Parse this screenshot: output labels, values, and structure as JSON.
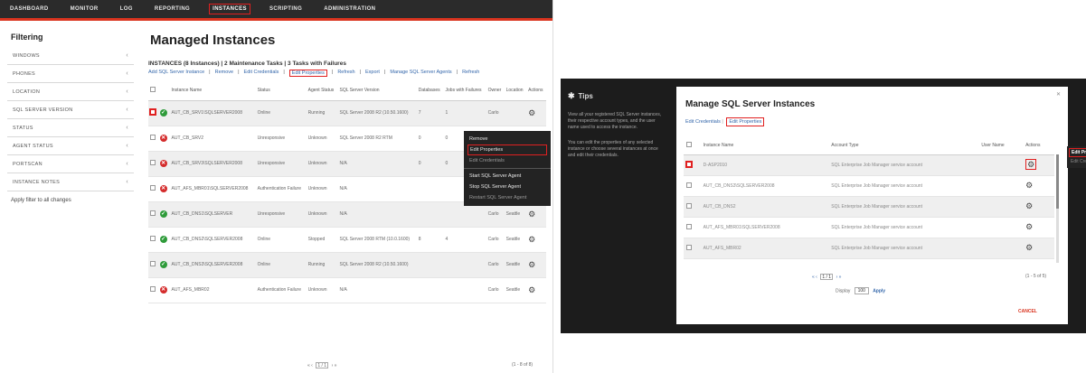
{
  "left": {
    "nav": [
      "DASHBOARD",
      "MONITOR",
      "LOG",
      "REPORTING",
      "INSTANCES",
      "SCRIPTING",
      "ADMINISTRATION"
    ],
    "nav_active_index": 4,
    "sidebar": {
      "title": "Filtering",
      "filters": [
        "WINDOWS",
        "PHONES",
        "LOCATION",
        "SQL SERVER VERSION",
        "STATUS",
        "AGENT STATUS",
        "PORTSCAN",
        "INSTANCE NOTES"
      ],
      "apply_label": "Apply filter to all changes"
    },
    "title": "Managed Instances",
    "summary": "INSTANCES (8 Instances) | 2 Maintenance Tasks | 3 Tasks with Failures",
    "actions": [
      {
        "label": "Add SQL Server Instance",
        "hl": false
      },
      {
        "label": "Remove",
        "hl": false
      },
      {
        "label": "Edit Credentials",
        "hl": false
      },
      {
        "label": "Edit Properties",
        "hl": true
      },
      {
        "label": "Refresh",
        "hl": false
      },
      {
        "label": "Export",
        "hl": false
      },
      {
        "label": "Manage SQL Server Agents",
        "hl": false
      },
      {
        "label": "Refresh",
        "hl": false
      }
    ],
    "columns": [
      "Instance Name",
      "Status",
      "Agent Status",
      "SQL Server Version",
      "Databases",
      "Jobs with Failures",
      "Owner",
      "Location",
      "Actions"
    ],
    "rows": [
      {
        "name": "AUT_CB_SRV1\\SQLSERVER2008",
        "status": "ok",
        "state": "Online",
        "agent": "Running",
        "version": "SQL Server 2008 R2 (10.50.1600)",
        "dbs": "7",
        "jobs": "1",
        "owner": "Carlo",
        "loc": "",
        "cb_hl": true,
        "shade": true
      },
      {
        "name": "AUT_CB_SRV2",
        "status": "err",
        "state": "Unresponsive",
        "agent": "Unknown",
        "version": "SQL Server 2008 R2 RTM",
        "dbs": "0",
        "jobs": "0",
        "owner": "Carlo",
        "loc": "",
        "cb_hl": false,
        "shade": false
      },
      {
        "name": "AUT_CB_SRV3\\SQLSERVER2008",
        "status": "err",
        "state": "Unresponsive",
        "agent": "Unknown",
        "version": "N/A",
        "dbs": "0",
        "jobs": "0",
        "owner": "Carlo",
        "loc": "",
        "cb_hl": false,
        "shade": true
      },
      {
        "name": "AUT_AFS_MBR01\\SQLSERVER2008",
        "status": "err",
        "state": "Authentication Failure",
        "agent": "Unknown",
        "version": "N/A",
        "dbs": "",
        "jobs": "",
        "owner": "Carlo",
        "loc": "Seattle",
        "cb_hl": false,
        "shade": false
      },
      {
        "name": "AUT_CB_DNS1\\SQLSERVER",
        "status": "ok",
        "state": "Unresponsive",
        "agent": "Unknown",
        "version": "N/A",
        "dbs": "",
        "jobs": "",
        "owner": "Carlo",
        "loc": "Seattle",
        "cb_hl": false,
        "shade": true
      },
      {
        "name": "AUT_CB_DNS2\\SQLSERVER2008",
        "status": "ok",
        "state": "Online",
        "agent": "Stopped",
        "version": "SQL Server 2008 RTM (10.0.1600)",
        "dbs": "8",
        "jobs": "4",
        "owner": "Carlo",
        "loc": "Seattle",
        "cb_hl": false,
        "shade": false
      },
      {
        "name": "AUT_CB_DNS3\\SQLSERVER2008",
        "status": "ok",
        "state": "Online",
        "agent": "Running",
        "version": "SQL Server 2008 R2 (10.50.1600)",
        "dbs": "",
        "jobs": "",
        "owner": "Carlo",
        "loc": "Seattle",
        "cb_hl": false,
        "shade": true
      },
      {
        "name": "AUT_AFS_MBR02",
        "status": "err",
        "state": "Authentication Failure",
        "agent": "Unknown",
        "version": "N/A",
        "dbs": "",
        "jobs": "",
        "owner": "Carlo",
        "loc": "Seattle",
        "cb_hl": false,
        "shade": false
      }
    ],
    "context_menu": [
      "Remove",
      "Edit Properties",
      "Edit Credentials",
      "Start SQL Server Agent",
      "Stop SQL Server Agent",
      "Restart SQL Server Agent"
    ],
    "context_selected_index": 1,
    "pager_text": "1 / 1",
    "page_count": "(1 - 8 of 8)"
  },
  "right": {
    "tips_title": "Tips",
    "tips": [
      "View all your registered SQL Server instances, their respective account types, and the user name used to access the instance.",
      "You can edit the properties of any selected instance or choose several instances at once and edit their credentials."
    ],
    "dialog_title": "Manage SQL Server Instances",
    "link_edit_credentials": "Edit Credentials",
    "link_edit_properties": "Edit Properties",
    "columns": [
      "Instance Name",
      "Account Type",
      "User Name",
      "Actions"
    ],
    "rows": [
      {
        "name": "D-ASP2010",
        "type": "SQL Enterprise Job Manager service account",
        "shade": true,
        "cb_hl": true
      },
      {
        "name": "AUT_CB_DNS3\\SQLSERVER2008",
        "type": "SQL Enterprise Job Manager service account",
        "shade": false,
        "cb_hl": false
      },
      {
        "name": "AUT_CB_DNS2",
        "type": "SQL Enterprise Job Manager service account",
        "shade": true,
        "cb_hl": false
      },
      {
        "name": "AUT_AFS_MBR01\\SQLSERVER2008",
        "type": "SQL Enterprise Job Manager service account",
        "shade": false,
        "cb_hl": false
      },
      {
        "name": "AUT_AFS_MBR02",
        "type": "SQL Enterprise Job Manager service account",
        "shade": true,
        "cb_hl": false
      }
    ],
    "context_menu": [
      "Edit Properties",
      "Edit Credentials"
    ],
    "pager_text": "1 / 1",
    "count_text": "(1 - 5 of 5)",
    "display_label": "Display",
    "display_value": "100",
    "apply_label": "Apply",
    "cancel_label": "CANCEL"
  }
}
